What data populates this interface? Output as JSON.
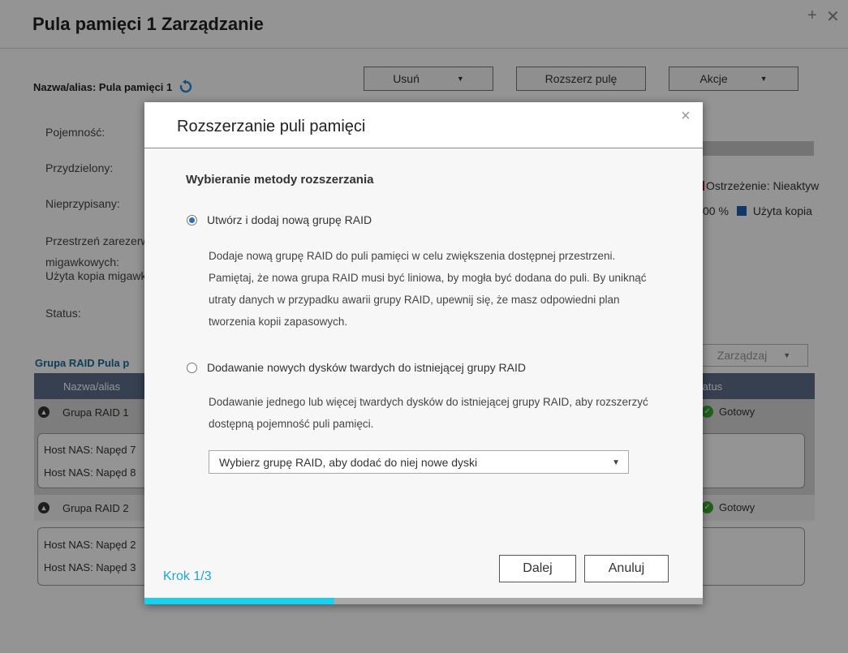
{
  "window": {
    "title": "Pula pamięci 1 Zarządzanie",
    "plus": "+",
    "close": "✕"
  },
  "pool": {
    "alias_label": "Nazwa/alias: Pula pamięci 1",
    "buttons": {
      "remove": "Usuń",
      "expand": "Rozszerz pulę",
      "actions": "Akcje"
    },
    "info_labels": {
      "capacity": "Pojemność:",
      "allocated": "Przydzielony:",
      "unallocated": "Nieprzypisany:",
      "reserved_line1": "Przestrzeń zarezerw",
      "reserved_line2": "migawkowych:",
      "reserved_line3": "Użyta kopia migawk",
      "status": "Status:"
    },
    "legend": {
      "warning": "Ostrzeżenie: Nieaktyw",
      "percent": "00 %",
      "used_copy": "Użyta kopia"
    },
    "colors": {
      "warning": "#b01818",
      "used_copy": "#1f5fb0"
    }
  },
  "raid": {
    "title": "Grupa RAID Pula p",
    "manage": "Zarządzaj",
    "columns": {
      "name": "Nazwa/alias",
      "status": "tatus"
    },
    "groups": [
      {
        "name": "Grupa RAID 1",
        "status": "Gotowy",
        "disks": [
          "Host NAS: Napęd 7",
          "Host NAS: Napęd 8"
        ]
      },
      {
        "name": "Grupa RAID 2",
        "status": "Gotowy",
        "disks": [
          "Host NAS: Napęd 2",
          "Host NAS: Napęd 3"
        ]
      }
    ]
  },
  "dialog": {
    "title": "Rozszerzanie puli pamięci",
    "close": "×",
    "section_title": "Wybieranie metody rozszerzania",
    "options": [
      {
        "label": "Utwórz i dodaj nową grupę RAID",
        "selected": true,
        "description_lines": [
          "Dodaje nową grupę RAID do puli pamięci w celu zwiększenia dostępnej przestrzeni.",
          "Pamiętaj, że nowa grupa RAID musi być liniowa, by mogła być dodana do puli. By uniknąć",
          "utraty danych w przypadku awarii grupy RAID, upewnij się, że masz odpowiedni plan",
          "tworzenia kopii zapasowych."
        ]
      },
      {
        "label": "Dodawanie nowych dysków twardych do istniejącej grupy RAID",
        "selected": false,
        "description_lines": [
          "Dodawanie jednego lub więcej twardych dysków do istniejącej grupy RAID, aby rozszerzyć",
          "dostępną pojemność puli pamięci."
        ]
      }
    ],
    "select_value": "Wybierz grupę RAID, aby dodać do niej nowe dyski",
    "step": "Krok 1/3",
    "next": "Dalej",
    "cancel": "Anuluj",
    "progress": 0.34,
    "colors": {
      "progress": "#16d2f0",
      "step": "#1ba8d4",
      "radio": "#2a6fb0"
    }
  }
}
